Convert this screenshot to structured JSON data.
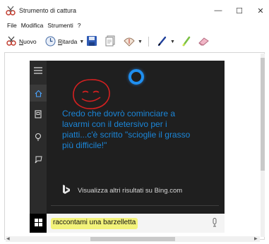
{
  "window": {
    "title": "Strumento di cattura",
    "min_glyph": "—",
    "max_glyph": "☐",
    "close_glyph": "✕"
  },
  "menu": [
    "File",
    "Modifica",
    "Strumenti",
    "?"
  ],
  "toolbar": {
    "new_label": "Nuovo",
    "new_accel": "N",
    "delay_label": "Ritarda",
    "delay_accel": "R"
  },
  "capture": {
    "joke_text": "Credo che dovrò cominciare a lavarmi con il detersivo per i piatti...c'è scritto \"scioglie il grasso più difficile!\"",
    "bing_text": "Visualizza altri risultati su Bing.com",
    "search_text": "raccontami una barzelletta"
  },
  "colors": {
    "cortana_blue": "#1f8ff0",
    "joke_blue": "#1b86d8",
    "highlight_yellow": "#f3f37a",
    "annotation_red": "#d42020",
    "panel_bg": "#1f1f1f"
  },
  "icons": [
    "snipping-tool-icon",
    "new-snip-icon",
    "delay-icon",
    "save-icon",
    "copy-icon",
    "send-icon",
    "pen-icon",
    "highlighter-icon",
    "eraser-icon",
    "hamburger-icon",
    "home-icon",
    "notebook-icon",
    "lightbulb-icon",
    "feedback-icon",
    "windows-icon",
    "bing-icon",
    "microphone-icon"
  ]
}
